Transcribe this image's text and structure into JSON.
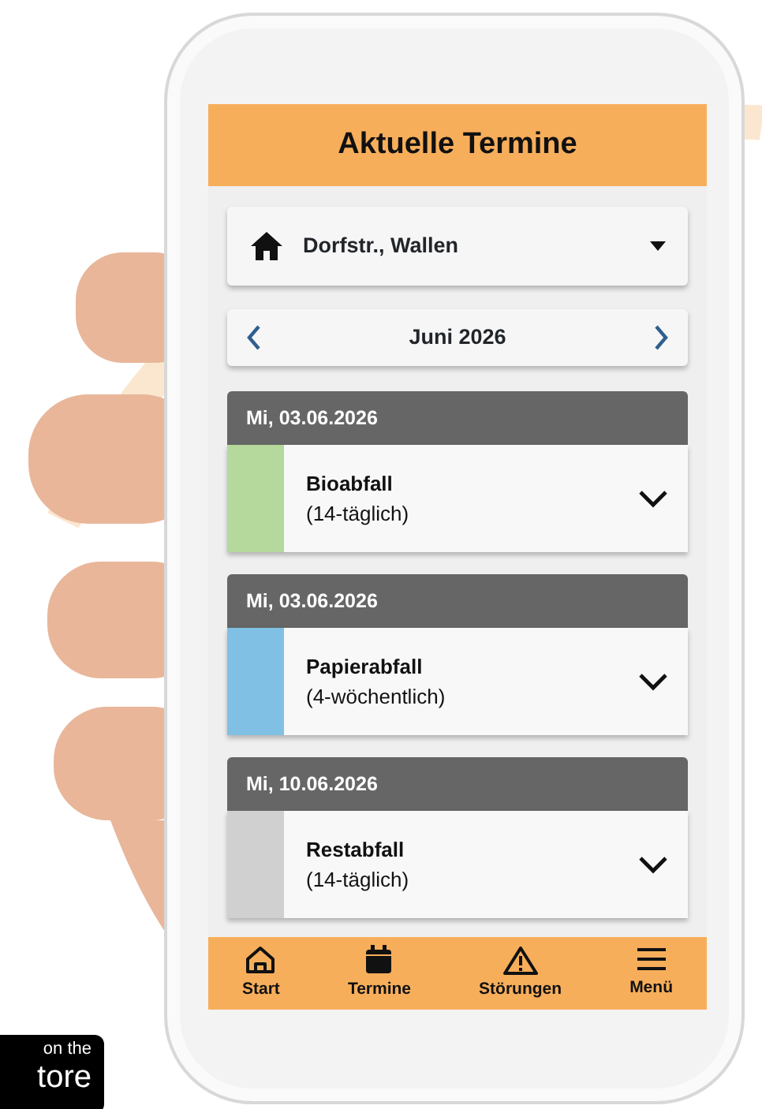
{
  "header": {
    "title": "Aktuelle Termine"
  },
  "location": {
    "label": "Dorfstr., Wallen"
  },
  "month": {
    "label": "Juni 2026"
  },
  "entries": [
    {
      "date": "Mi, 03.06.2026",
      "name": "Bioabfall",
      "interval": "(14-täglich)",
      "color": "#b5d89c"
    },
    {
      "date": "Mi, 03.06.2026",
      "name": "Papierabfall",
      "interval": "(4-wöchentlich)",
      "color": "#80c0e4"
    },
    {
      "date": "Mi, 10.06.2026",
      "name": "Restabfall",
      "interval": "(14-täglich)",
      "color": "#d0d0d0"
    }
  ],
  "bottom_nav": [
    {
      "kind": "home",
      "label": "Start"
    },
    {
      "kind": "calendar",
      "label": "Termine"
    },
    {
      "kind": "warning",
      "label": "Störungen"
    },
    {
      "kind": "menu",
      "label": "Menü"
    }
  ],
  "store_badge": {
    "line_1": "on the",
    "line_2": "tore"
  }
}
